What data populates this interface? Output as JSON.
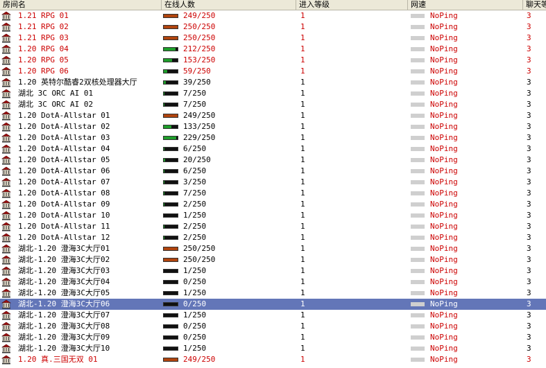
{
  "columns": {
    "name": "房间名",
    "online": "在线人数",
    "level": "进入等级",
    "ping": "网速",
    "chat": "聊天等"
  },
  "colors": {
    "bar_green": "#1e9e2a",
    "bar_orange": "#b0440e",
    "selected_bg": "#6376b8",
    "red_text": "#cc0000"
  },
  "rooms": [
    {
      "name": "1.21 RPG 01",
      "online": "249/250",
      "fill": 0.996,
      "level": "1",
      "ping": "NoPing",
      "chat": "3",
      "red": true
    },
    {
      "name": "1.21 RPG 02",
      "online": "250/250",
      "fill": 1.0,
      "level": "1",
      "ping": "NoPing",
      "chat": "3",
      "red": true
    },
    {
      "name": "1.21 RPG 03",
      "online": "250/250",
      "fill": 1.0,
      "level": "1",
      "ping": "NoPing",
      "chat": "3",
      "red": true
    },
    {
      "name": "1.20 RPG 04",
      "online": "212/250",
      "fill": 0.848,
      "level": "1",
      "ping": "NoPing",
      "chat": "3",
      "red": true
    },
    {
      "name": "1.20 RPG 05",
      "online": "153/250",
      "fill": 0.612,
      "level": "1",
      "ping": "NoPing",
      "chat": "3",
      "red": true
    },
    {
      "name": "1.20 RPG 06",
      "online": "59/250",
      "fill": 0.236,
      "level": "1",
      "ping": "NoPing",
      "chat": "3",
      "red": true
    },
    {
      "name": "1.20 英特尔酷睿2双核处理器大厅",
      "online": "39/250",
      "fill": 0.156,
      "level": "1",
      "ping": "NoPing",
      "chat": "3",
      "red": false
    },
    {
      "name": "湖北 3C ORC AI 01",
      "online": "7/250",
      "fill": 0.028,
      "level": "1",
      "ping": "NoPing",
      "chat": "3",
      "red": false
    },
    {
      "name": "湖北 3C ORC AI 02",
      "online": "7/250",
      "fill": 0.028,
      "level": "1",
      "ping": "NoPing",
      "chat": "3",
      "red": false
    },
    {
      "name": "1.20 DotA-Allstar 01",
      "online": "249/250",
      "fill": 0.996,
      "level": "1",
      "ping": "NoPing",
      "chat": "3",
      "red": false
    },
    {
      "name": "1.20 DotA-Allstar 02",
      "online": "133/250",
      "fill": 0.532,
      "level": "1",
      "ping": "NoPing",
      "chat": "3",
      "red": false
    },
    {
      "name": "1.20 DotA-Allstar 03",
      "online": "229/250",
      "fill": 0.916,
      "level": "1",
      "ping": "NoPing",
      "chat": "3",
      "red": false
    },
    {
      "name": "1.20 DotA-Allstar 04",
      "online": "6/250",
      "fill": 0.024,
      "level": "1",
      "ping": "NoPing",
      "chat": "3",
      "red": false
    },
    {
      "name": "1.20 DotA-Allstar 05",
      "online": "20/250",
      "fill": 0.08,
      "level": "1",
      "ping": "NoPing",
      "chat": "3",
      "red": false
    },
    {
      "name": "1.20 DotA-Allstar 06",
      "online": "6/250",
      "fill": 0.024,
      "level": "1",
      "ping": "NoPing",
      "chat": "3",
      "red": false
    },
    {
      "name": "1.20 DotA-Allstar 07",
      "online": "3/250",
      "fill": 0.012,
      "level": "1",
      "ping": "NoPing",
      "chat": "3",
      "red": false
    },
    {
      "name": "1.20 DotA-Allstar 08",
      "online": "7/250",
      "fill": 0.028,
      "level": "1",
      "ping": "NoPing",
      "chat": "3",
      "red": false
    },
    {
      "name": "1.20 DotA-Allstar 09",
      "online": "2/250",
      "fill": 0.008,
      "level": "1",
      "ping": "NoPing",
      "chat": "3",
      "red": false
    },
    {
      "name": "1.20 DotA-Allstar 10",
      "online": "1/250",
      "fill": 0.004,
      "level": "1",
      "ping": "NoPing",
      "chat": "3",
      "red": false
    },
    {
      "name": "1.20 DotA-Allstar 11",
      "online": "2/250",
      "fill": 0.008,
      "level": "1",
      "ping": "NoPing",
      "chat": "3",
      "red": false
    },
    {
      "name": "1.20 DotA-Allstar 12",
      "online": "2/250",
      "fill": 0.008,
      "level": "1",
      "ping": "NoPing",
      "chat": "3",
      "red": false
    },
    {
      "name": "湖北-1.20 澄海3C大厅01",
      "online": "250/250",
      "fill": 1.0,
      "level": "1",
      "ping": "NoPing",
      "chat": "3",
      "red": false
    },
    {
      "name": "湖北-1.20 澄海3C大厅02",
      "online": "250/250",
      "fill": 1.0,
      "level": "1",
      "ping": "NoPing",
      "chat": "3",
      "red": false
    },
    {
      "name": "湖北-1.20 澄海3C大厅03",
      "online": "1/250",
      "fill": 0.004,
      "level": "1",
      "ping": "NoPing",
      "chat": "3",
      "red": false
    },
    {
      "name": "湖北-1.20 澄海3C大厅04",
      "online": "0/250",
      "fill": 0.0,
      "level": "1",
      "ping": "NoPing",
      "chat": "3",
      "red": false
    },
    {
      "name": "湖北-1.20 澄海3C大厅05",
      "online": "1/250",
      "fill": 0.004,
      "level": "1",
      "ping": "NoPing",
      "chat": "3",
      "red": false
    },
    {
      "name": "湖北-1.20 澄海3C大厅06",
      "online": "0/250",
      "fill": 0.0,
      "level": "1",
      "ping": "NoPing",
      "chat": "3",
      "red": false,
      "selected": true
    },
    {
      "name": "湖北-1.20 澄海3C大厅07",
      "online": "1/250",
      "fill": 0.004,
      "level": "1",
      "ping": "NoPing",
      "chat": "3",
      "red": false
    },
    {
      "name": "湖北-1.20 澄海3C大厅08",
      "online": "0/250",
      "fill": 0.0,
      "level": "1",
      "ping": "NoPing",
      "chat": "3",
      "red": false
    },
    {
      "name": "湖北-1.20 澄海3C大厅09",
      "online": "0/250",
      "fill": 0.0,
      "level": "1",
      "ping": "NoPing",
      "chat": "3",
      "red": false
    },
    {
      "name": "湖北-1.20 澄海3C大厅10",
      "online": "1/250",
      "fill": 0.004,
      "level": "1",
      "ping": "NoPing",
      "chat": "3",
      "red": false
    },
    {
      "name": "1.20 真.三国无双 01",
      "online": "249/250",
      "fill": 0.996,
      "level": "1",
      "ping": "NoPing",
      "chat": "3",
      "red": true
    }
  ]
}
